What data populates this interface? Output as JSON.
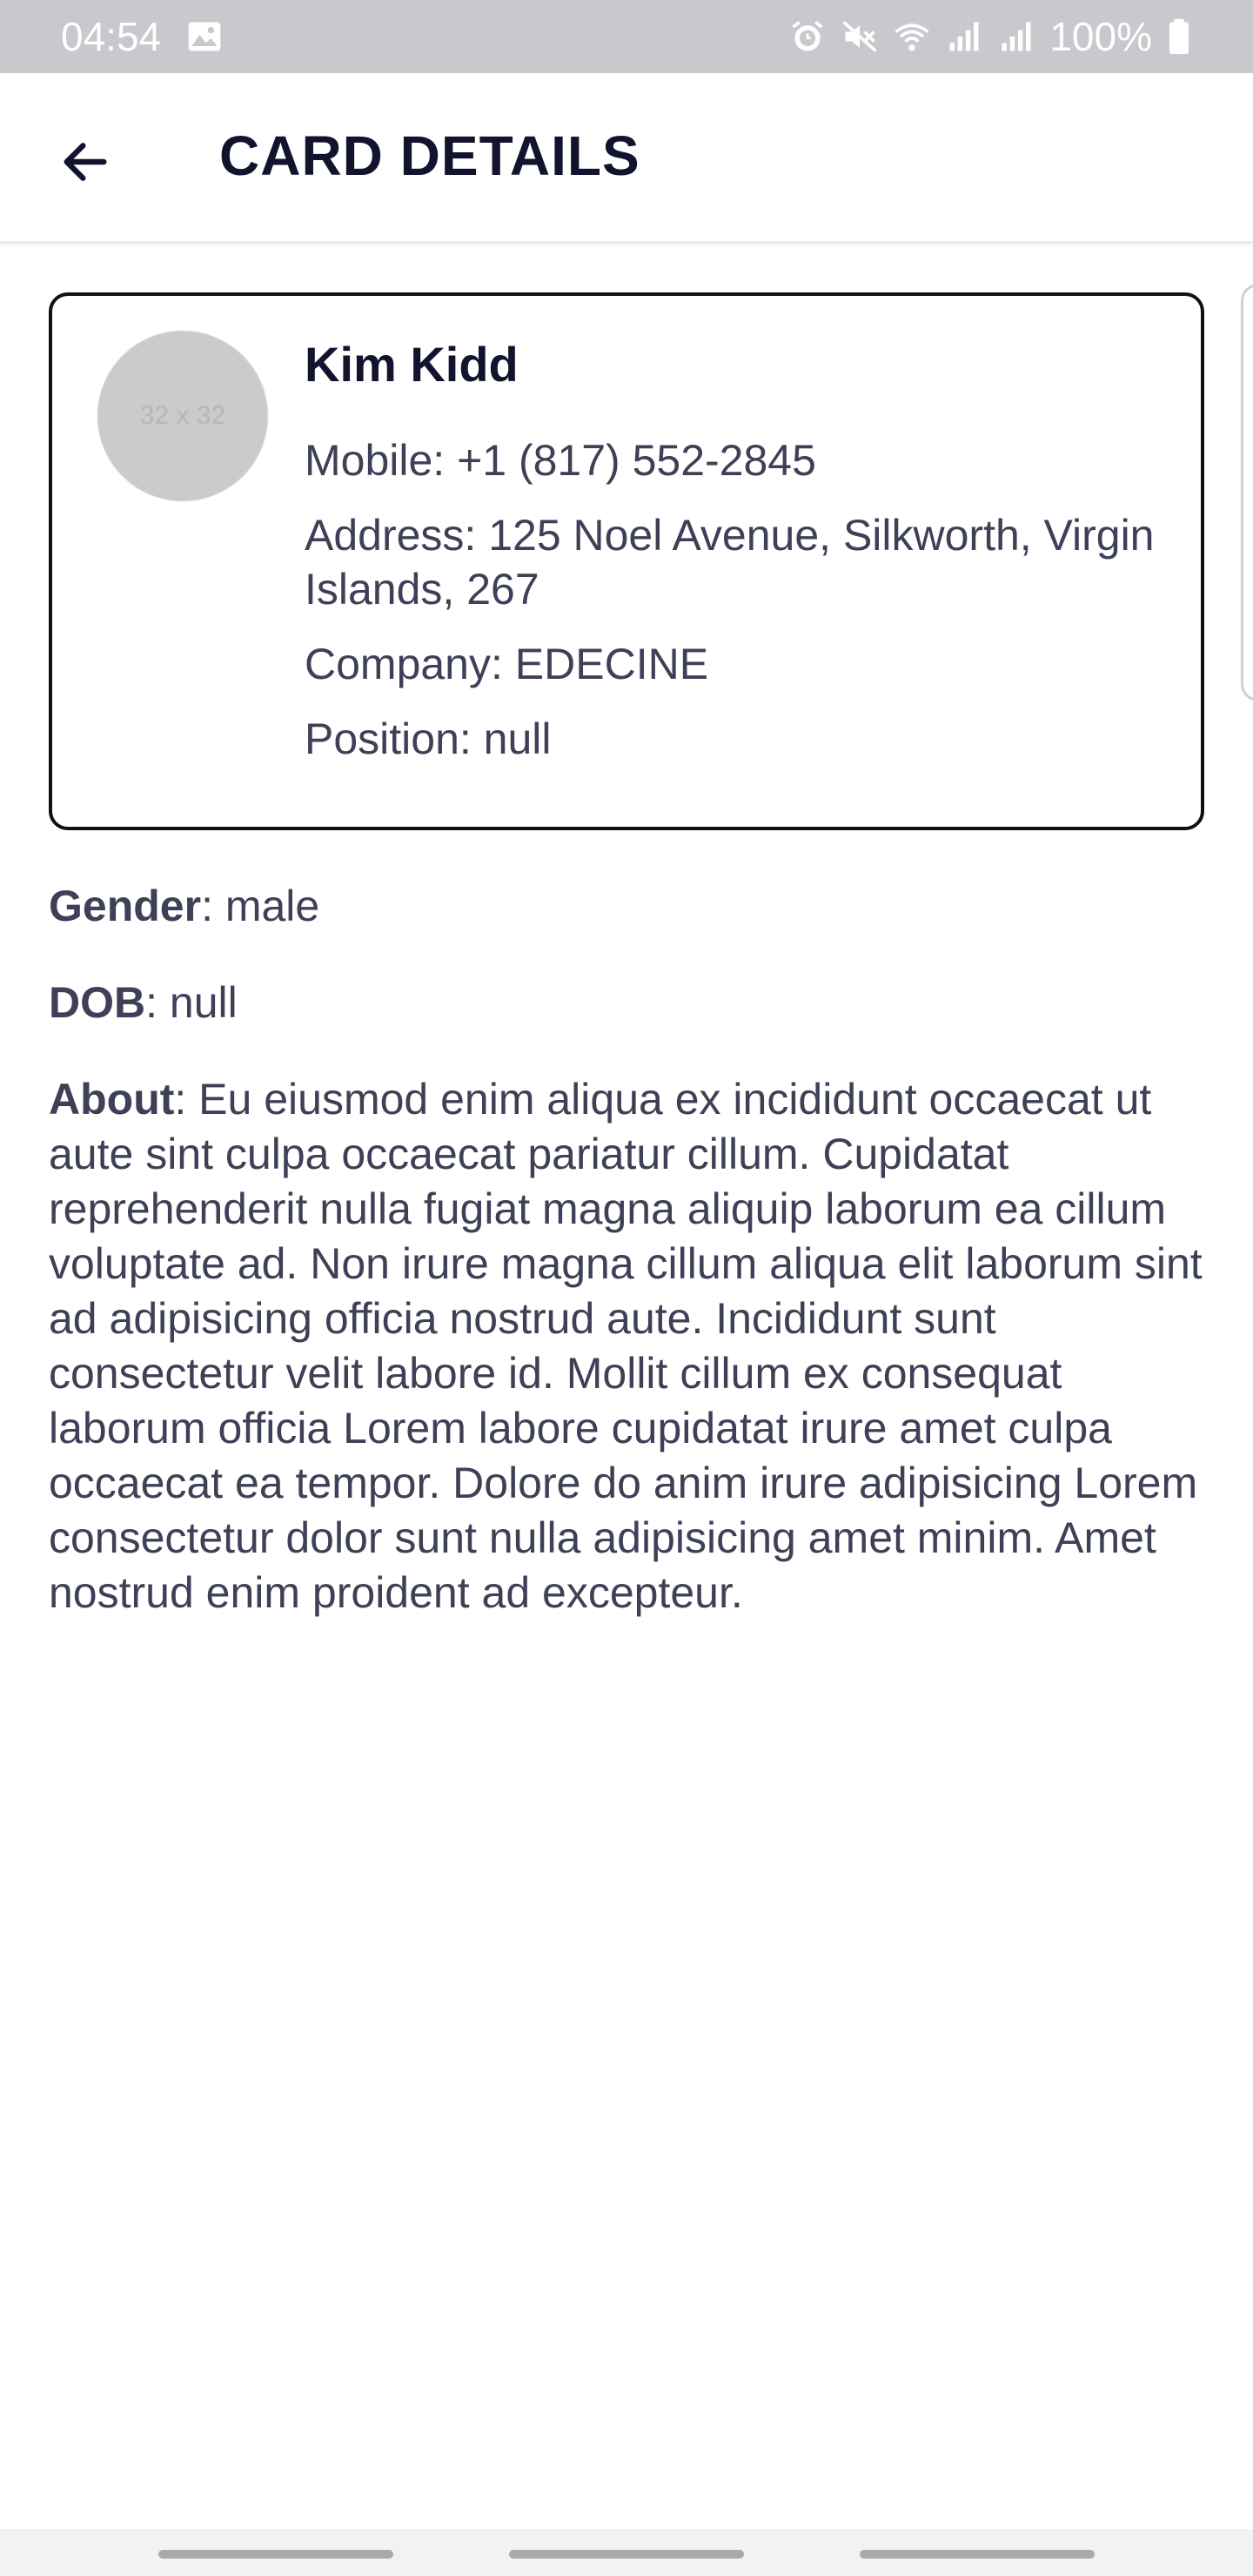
{
  "status_bar": {
    "time": "04:54",
    "battery_percent": "100%",
    "icons": [
      "image-icon",
      "alarm-icon",
      "mute-icon",
      "wifi-icon",
      "signal-icon",
      "signal-icon",
      "battery-icon"
    ]
  },
  "app_bar": {
    "title": "CARD DETAILS",
    "back_icon": "back-arrow-icon"
  },
  "card": {
    "avatar_text": "32 x 32",
    "name": "Kim Kidd",
    "mobile": "Mobile: +1 (817) 552-2845",
    "address": "Address: 125 Noel Avenue, Silkworth, Virgin Islands, 267",
    "company": "Company: EDECINE",
    "position": "Position: null"
  },
  "details": {
    "gender_label": "Gender",
    "gender_value": ": male",
    "dob_label": "DOB",
    "dob_value": ": null",
    "about_label": "About",
    "about_value": ": Eu eiusmod enim aliqua ex incididunt occaecat ut aute sint culpa occaecat pariatur cillum. Cupidatat reprehenderit nulla fugiat magna aliquip laborum ea cillum voluptate ad. Non irure magna cillum aliqua elit laborum sint ad adipisicing officia nostrud aute. Incididunt sunt consectetur velit labore id. Mollit cillum ex consequat laborum officia Lorem labore cupidatat irure amet culpa occaecat ea tempor. Dolore do anim irure adipisicing Lorem consectetur dolor sunt nulla adipisicing amet minim. Amet nostrud enim proident ad excepteur."
  },
  "colors": {
    "title": "#12142e",
    "body_text": "#3e4057",
    "card_border": "#111111",
    "status_bar": "#c8c9cd"
  }
}
